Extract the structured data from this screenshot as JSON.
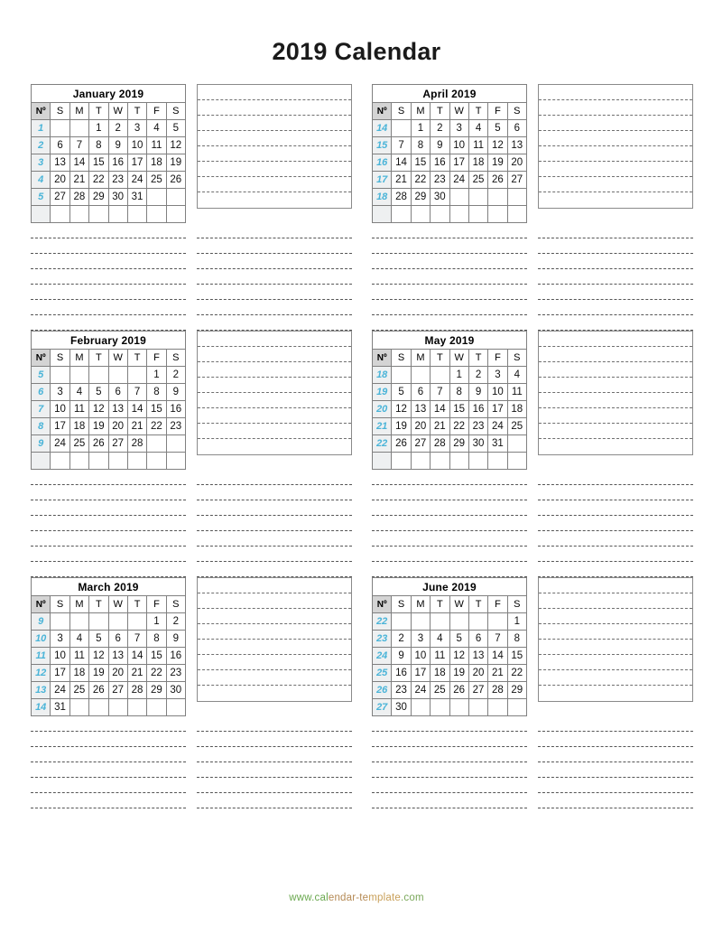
{
  "page": {
    "title": "2019 Calendar",
    "footer_url": "www.calendar-template.com",
    "footer_parts": [
      "www.cal",
      "endar-te",
      "mplate",
      ".com"
    ],
    "accent_week_color": "#4ab4d8",
    "header_bg_color": "#d4d4d4",
    "week_col_bg_color": "#eef0f1",
    "border_color": "#808080"
  },
  "weekday_headers": [
    "Nº",
    "S",
    "M",
    "T",
    "W",
    "T",
    "F",
    "S"
  ],
  "notes": {
    "line_count": 8
  },
  "strips": [
    {
      "name": "strip-after-row1",
      "line_count": 7
    },
    {
      "name": "strip-after-row2",
      "line_count": 7
    },
    {
      "name": "strip-after-row3",
      "line_count": 6
    }
  ],
  "months": [
    {
      "id": "january",
      "title": "January 2019",
      "weeks": [
        {
          "no": "1",
          "days": [
            "",
            "",
            "1",
            "2",
            "3",
            "4",
            "5"
          ]
        },
        {
          "no": "2",
          "days": [
            "6",
            "7",
            "8",
            "9",
            "10",
            "11",
            "12"
          ]
        },
        {
          "no": "3",
          "days": [
            "13",
            "14",
            "15",
            "16",
            "17",
            "18",
            "19"
          ]
        },
        {
          "no": "4",
          "days": [
            "20",
            "21",
            "22",
            "23",
            "24",
            "25",
            "26"
          ]
        },
        {
          "no": "5",
          "days": [
            "27",
            "28",
            "29",
            "30",
            "31",
            "",
            ""
          ]
        },
        {
          "no": "",
          "days": [
            "",
            "",
            "",
            "",
            "",
            "",
            ""
          ]
        }
      ]
    },
    {
      "id": "february",
      "title": "February 2019",
      "weeks": [
        {
          "no": "5",
          "days": [
            "",
            "",
            "",
            "",
            "",
            "1",
            "2"
          ]
        },
        {
          "no": "6",
          "days": [
            "3",
            "4",
            "5",
            "6",
            "7",
            "8",
            "9"
          ]
        },
        {
          "no": "7",
          "days": [
            "10",
            "11",
            "12",
            "13",
            "14",
            "15",
            "16"
          ]
        },
        {
          "no": "8",
          "days": [
            "17",
            "18",
            "19",
            "20",
            "21",
            "22",
            "23"
          ]
        },
        {
          "no": "9",
          "days": [
            "24",
            "25",
            "26",
            "27",
            "28",
            "",
            ""
          ]
        },
        {
          "no": "",
          "days": [
            "",
            "",
            "",
            "",
            "",
            "",
            ""
          ]
        }
      ]
    },
    {
      "id": "march",
      "title": "March 2019",
      "weeks": [
        {
          "no": "9",
          "days": [
            "",
            "",
            "",
            "",
            "",
            "1",
            "2"
          ]
        },
        {
          "no": "10",
          "days": [
            "3",
            "4",
            "5",
            "6",
            "7",
            "8",
            "9"
          ]
        },
        {
          "no": "11",
          "days": [
            "10",
            "11",
            "12",
            "13",
            "14",
            "15",
            "16"
          ]
        },
        {
          "no": "12",
          "days": [
            "17",
            "18",
            "19",
            "20",
            "21",
            "22",
            "23"
          ]
        },
        {
          "no": "13",
          "days": [
            "24",
            "25",
            "26",
            "27",
            "28",
            "29",
            "30"
          ]
        },
        {
          "no": "14",
          "days": [
            "31",
            "",
            "",
            "",
            "",
            "",
            ""
          ]
        }
      ]
    },
    {
      "id": "april",
      "title": "April 2019",
      "weeks": [
        {
          "no": "14",
          "days": [
            "",
            "1",
            "2",
            "3",
            "4",
            "5",
            "6"
          ]
        },
        {
          "no": "15",
          "days": [
            "7",
            "8",
            "9",
            "10",
            "11",
            "12",
            "13"
          ]
        },
        {
          "no": "16",
          "days": [
            "14",
            "15",
            "16",
            "17",
            "18",
            "19",
            "20"
          ]
        },
        {
          "no": "17",
          "days": [
            "21",
            "22",
            "23",
            "24",
            "25",
            "26",
            "27"
          ]
        },
        {
          "no": "18",
          "days": [
            "28",
            "29",
            "30",
            "",
            "",
            "",
            ""
          ]
        },
        {
          "no": "",
          "days": [
            "",
            "",
            "",
            "",
            "",
            "",
            ""
          ]
        }
      ]
    },
    {
      "id": "may",
      "title": "May 2019",
      "weeks": [
        {
          "no": "18",
          "days": [
            "",
            "",
            "",
            "1",
            "2",
            "3",
            "4"
          ]
        },
        {
          "no": "19",
          "days": [
            "5",
            "6",
            "7",
            "8",
            "9",
            "10",
            "11"
          ]
        },
        {
          "no": "20",
          "days": [
            "12",
            "13",
            "14",
            "15",
            "16",
            "17",
            "18"
          ]
        },
        {
          "no": "21",
          "days": [
            "19",
            "20",
            "21",
            "22",
            "23",
            "24",
            "25"
          ]
        },
        {
          "no": "22",
          "days": [
            "26",
            "27",
            "28",
            "29",
            "30",
            "31",
            ""
          ]
        },
        {
          "no": "",
          "days": [
            "",
            "",
            "",
            "",
            "",
            "",
            ""
          ]
        }
      ]
    },
    {
      "id": "june",
      "title": "June 2019",
      "weeks": [
        {
          "no": "22",
          "days": [
            "",
            "",
            "",
            "",
            "",
            "",
            "1"
          ]
        },
        {
          "no": "23",
          "days": [
            "2",
            "3",
            "4",
            "5",
            "6",
            "7",
            "8"
          ]
        },
        {
          "no": "24",
          "days": [
            "9",
            "10",
            "11",
            "12",
            "13",
            "14",
            "15"
          ]
        },
        {
          "no": "25",
          "days": [
            "16",
            "17",
            "18",
            "19",
            "20",
            "21",
            "22"
          ]
        },
        {
          "no": "26",
          "days": [
            "23",
            "24",
            "25",
            "26",
            "27",
            "28",
            "29"
          ]
        },
        {
          "no": "27",
          "days": [
            "30",
            "",
            "",
            "",
            "",
            "",
            ""
          ]
        }
      ]
    }
  ],
  "layout": {
    "rows": [
      {
        "left_month": "january",
        "right_month": "april"
      },
      {
        "left_month": "february",
        "right_month": "may"
      },
      {
        "left_month": "march",
        "right_month": "june"
      }
    ]
  }
}
